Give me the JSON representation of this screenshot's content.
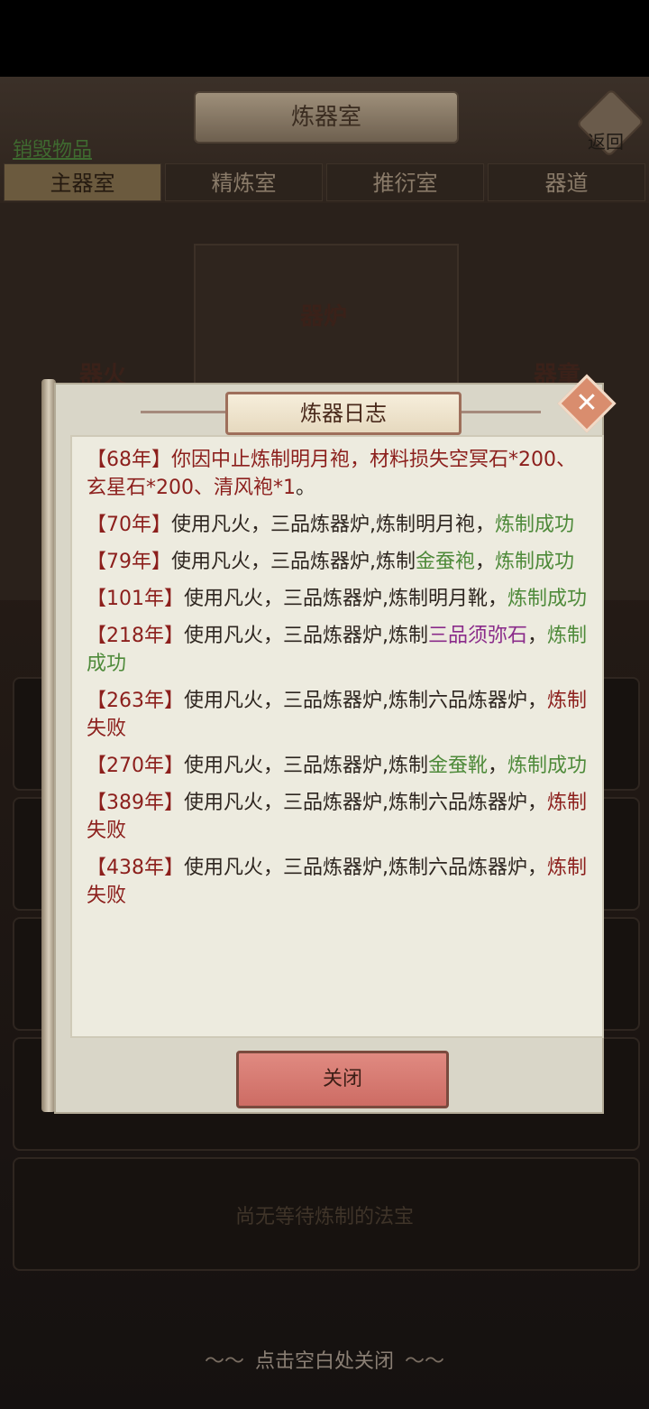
{
  "header": {
    "title": "炼器室",
    "back_label": "返回",
    "destroy_link": "销毁物品"
  },
  "tabs": [
    "主器室",
    "精炼室",
    "推衍室",
    "器道"
  ],
  "stage": {
    "furnace_label": "器炉",
    "fire_label": "器火",
    "right_label": "器童"
  },
  "empty_queue_text": "尚无等待炼制的法宝",
  "tap_close_text": "点击空白处关闭",
  "dialog": {
    "title": "炼器日志",
    "close_button": "关闭",
    "entries": [
      {
        "year": "【68年】",
        "segments": [
          {
            "text": "你因中止炼制明月袍，材料损失",
            "style": "red"
          },
          {
            "text": "空冥石*200、玄星石*200、清风袍*1",
            "style": "red"
          },
          {
            "text": "。",
            "style": "normal"
          }
        ]
      },
      {
        "year": "【70年】",
        "segments": [
          {
            "text": "使用凡火，三品炼器炉,炼制明月袍，",
            "style": "normal"
          },
          {
            "text": "炼制成功",
            "style": "green"
          }
        ]
      },
      {
        "year": "【79年】",
        "segments": [
          {
            "text": "使用凡火，三品炼器炉,炼制",
            "style": "normal"
          },
          {
            "text": "金蚕袍",
            "style": "green"
          },
          {
            "text": "，",
            "style": "normal"
          },
          {
            "text": "炼制成功",
            "style": "green"
          }
        ]
      },
      {
        "year": "【101年】",
        "segments": [
          {
            "text": "使用凡火，三品炼器炉,炼制明月靴，",
            "style": "normal"
          },
          {
            "text": "炼制成功",
            "style": "green"
          }
        ]
      },
      {
        "year": "【218年】",
        "segments": [
          {
            "text": "使用凡火，三品炼器炉,炼制",
            "style": "normal"
          },
          {
            "text": "三品须弥石",
            "style": "purple"
          },
          {
            "text": "，",
            "style": "normal"
          },
          {
            "text": "炼制成功",
            "style": "green"
          }
        ]
      },
      {
        "year": "【263年】",
        "segments": [
          {
            "text": "使用凡火，三品炼器炉,炼制六品炼器炉，",
            "style": "normal"
          },
          {
            "text": "炼制失败",
            "style": "red"
          }
        ]
      },
      {
        "year": "【270年】",
        "segments": [
          {
            "text": "使用凡火，三品炼器炉,炼制",
            "style": "normal"
          },
          {
            "text": "金蚕靴",
            "style": "green"
          },
          {
            "text": "，",
            "style": "normal"
          },
          {
            "text": "炼制成功",
            "style": "green"
          }
        ]
      },
      {
        "year": "【389年】",
        "segments": [
          {
            "text": "使用凡火，三品炼器炉,炼制六品炼器炉，",
            "style": "normal"
          },
          {
            "text": "炼制失败",
            "style": "red"
          }
        ]
      },
      {
        "year": "【438年】",
        "segments": [
          {
            "text": "使用凡火，三品炼器炉,炼制六品炼器炉，",
            "style": "normal"
          },
          {
            "text": "炼制失败",
            "style": "red"
          }
        ]
      }
    ]
  },
  "colors": {
    "success": "#4e8a3a",
    "fail": "#8c1f1c",
    "rare": "#8a2b8a",
    "button": "#d9776f"
  }
}
